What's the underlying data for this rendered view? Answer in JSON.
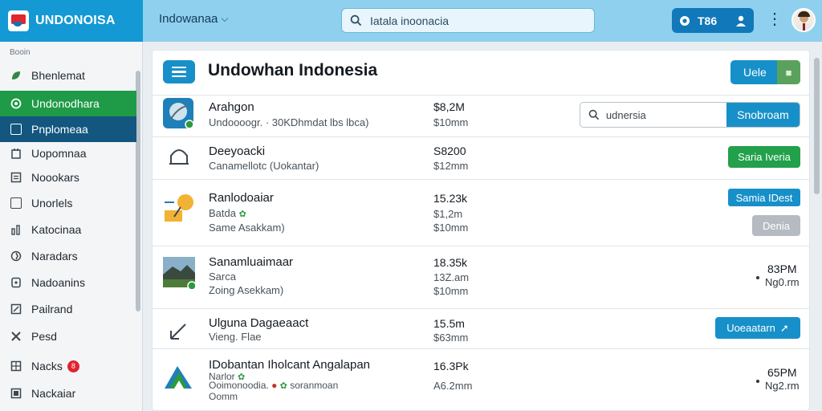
{
  "brand": {
    "name": "UNDONOISA"
  },
  "topbar": {
    "region": "Indowanaa",
    "search": {
      "placeholder": "Iatala inoonacia",
      "value": ""
    },
    "actions_label": "T86"
  },
  "sidebar": {
    "section_label": "Booin",
    "items": [
      {
        "label": "Bhenlemat",
        "icon": "leaf-icon"
      },
      {
        "label": "Undonodhara",
        "icon": "home-icon",
        "state": "active-green"
      },
      {
        "label": "Pnplomeaa",
        "icon": "card-icon",
        "state": "active-blue"
      },
      {
        "label": "Uopomnaa",
        "icon": "building-icon"
      },
      {
        "label": "Noookars",
        "icon": "list-icon"
      },
      {
        "label": "Unorlels",
        "icon": "square-icon"
      },
      {
        "label": "Katocinaa",
        "icon": "chart-icon"
      },
      {
        "label": "Naradars",
        "icon": "target-icon"
      },
      {
        "label": "Nadoanins",
        "icon": "doc-icon"
      },
      {
        "label": "Pailrand",
        "icon": "edit-icon"
      },
      {
        "label": "Pesd",
        "icon": "tools-icon"
      },
      {
        "label": "Nacks",
        "icon": "grid-icon",
        "badge": "8"
      },
      {
        "label": "Nackaiar",
        "icon": "box-icon"
      }
    ]
  },
  "main": {
    "title": "Undowhan Indonesia",
    "vue_button": "Uele",
    "row_search": {
      "placeholder": "udnersia",
      "button": "Snobroam"
    },
    "rows": [
      {
        "title": "Arahgon",
        "sub": "Undoooogr. · 30KDhmdat lbs lbca)",
        "num1": "$8,2M",
        "num2": "$10mm"
      },
      {
        "title": "Deeyoacki",
        "sub": "Canamellotc (Uokantar)",
        "num1": "S8200",
        "num2": "$12mm",
        "button": "Saria Iveria"
      },
      {
        "title": "Ranlodoaiar",
        "sub": "Batda",
        "sub2": "Same Asakkam)",
        "num1": "15.23k",
        "num2": "$1,2m",
        "num3": "$10mm",
        "button": "Samia IDest",
        "button2": "Denia"
      },
      {
        "title": "Sanamluaimaar",
        "sub": "Sarca",
        "sub2": "Zoing Asekkam)",
        "num1": "18.35k",
        "num2": "13Z.am",
        "num3": "$10mm",
        "time": "83PM",
        "time2": "Ng0.rm"
      },
      {
        "title": "Ulguna Dagaeaact",
        "sub": "Vieng. Flae",
        "num1": "15.5m",
        "num2": "$63mm",
        "button": "Uoeaatarn"
      },
      {
        "title": "IDobantan Iholcant Angalapan",
        "sub": "Narlor",
        "sub2": "Ooimonoodia.",
        "sub3": "Oomm",
        "sub2b": "soranmoan",
        "num1": "16.3Pk",
        "num2": "A6.2mm",
        "time": "65PM",
        "time2": "Ng2.rm"
      }
    ]
  },
  "colors": {
    "brand_blue": "#1499d4",
    "topbar": "#8fd0ee",
    "green": "#1f9a47",
    "navy": "#13567f",
    "accent": "#1790c9"
  }
}
